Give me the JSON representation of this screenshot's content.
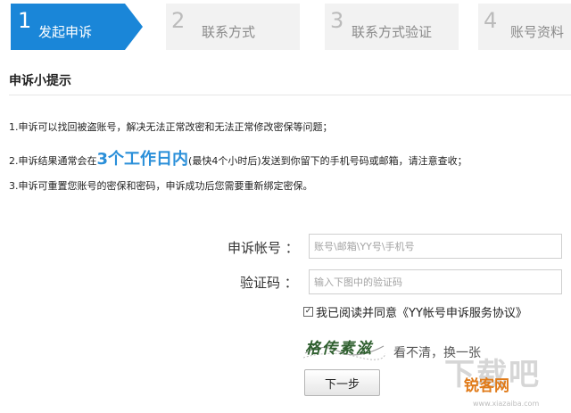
{
  "steps": [
    {
      "num": "1",
      "label": "发起申诉"
    },
    {
      "num": "2",
      "label": "联系方式"
    },
    {
      "num": "3",
      "label": "联系方式验证"
    },
    {
      "num": "4",
      "label": "账号资料"
    }
  ],
  "section_title": "申诉小提示",
  "tips": {
    "t1": "1.申诉可以找回被盗账号，解决无法正常改密和无法正常修改密保等问题；",
    "t2_pre": "2.申诉结果通常会在",
    "t2_highlight": "3个工作日内",
    "t2_post": "(最快4个小时后)发送到你留下的手机号码或邮箱，请注意查收；",
    "t3": "3.申诉可重置您账号的密保和密码，申诉成功后您需要重新绑定密保。"
  },
  "form": {
    "account_label": "申诉帐号 ：",
    "account_placeholder": "账号\\邮箱\\YY号\\手机号",
    "code_label": "验证码 ：",
    "code_placeholder": "输入下图中的验证码",
    "agree_text": "我已阅读并同意《YY帐号申诉服务协议》",
    "agree_checked": true,
    "captcha_text": "格传素滋",
    "refresh_text": "看不清，换一张",
    "next_label": "下一步"
  },
  "watermark": {
    "text1": "下载吧",
    "text2": "锐客网",
    "text3": "www.xiazaiba.com"
  },
  "colors": {
    "active_step": "#1a86d8",
    "highlight": "#2a8fd9",
    "inactive_text": "#8a8a8a",
    "inactive_bg": "#f2f2f2"
  }
}
